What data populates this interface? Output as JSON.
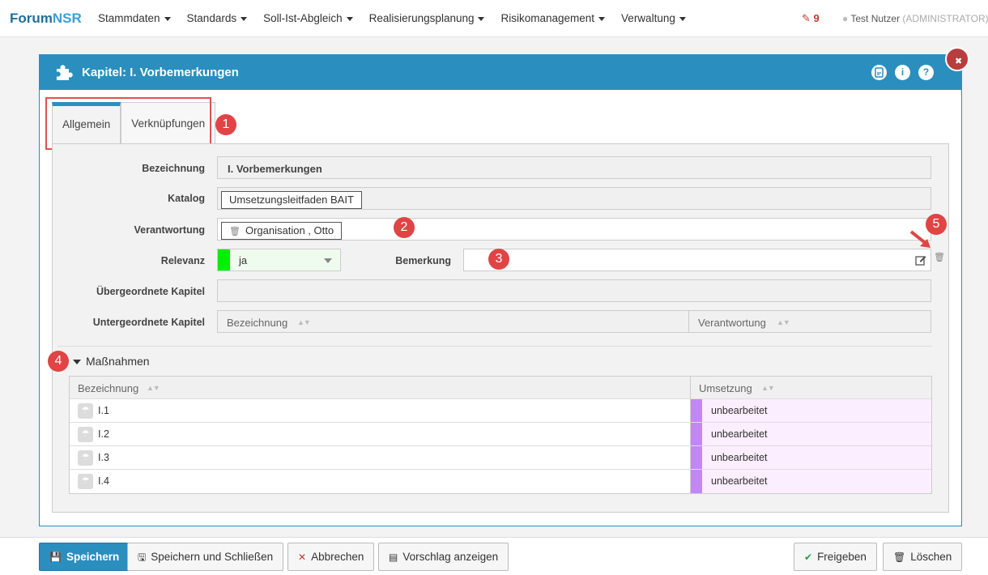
{
  "navbar": {
    "brand_part1": "Forum",
    "brand_part2": "NSR",
    "items": [
      {
        "label": "Stammdaten"
      },
      {
        "label": "Standards"
      },
      {
        "label": "Soll-Ist-Abgleich"
      },
      {
        "label": "Realisierungsplanung"
      },
      {
        "label": "Risikomanagement"
      },
      {
        "label": "Verwaltung"
      }
    ],
    "notification_count": "9",
    "user_name": "Test Nutzer",
    "user_role": "(ADMINISTRATOR)"
  },
  "panel": {
    "title": "Kapitel: I. Vorbemerkungen",
    "header_icons": [
      "pdf-icon",
      "info-icon",
      "help-icon"
    ],
    "info_glyph": "i",
    "help_glyph": "?",
    "close_glyph": "✖"
  },
  "tabs": [
    {
      "label": "Allgemein",
      "active": true
    },
    {
      "label": "Verknüpfungen",
      "active": false
    }
  ],
  "form": {
    "bezeichnung_label": "Bezeichnung",
    "bezeichnung_value": "I. Vorbemerkungen",
    "katalog_label": "Katalog",
    "katalog_value": "Umsetzungsleitfaden BAIT",
    "verantwortung_label": "Verantwortung",
    "verantwortung_value": "Organisation , Otto",
    "relevanz_label": "Relevanz",
    "relevanz_value": "ja",
    "relevanz_color": "#00f000",
    "bemerkung_label": "Bemerkung",
    "bemerkung_value": "",
    "uebergeordnete_label": "Übergeordnete Kapitel",
    "untergeordnete_label": "Untergeordnete Kapitel",
    "untergeordnete_columns": [
      "Bezeichnung",
      "Verantwortung"
    ]
  },
  "markers": [
    "1",
    "2",
    "3",
    "4",
    "5"
  ],
  "massnahmen": {
    "title": "Maßnahmen",
    "columns": [
      "Bezeichnung",
      "Umsetzung"
    ],
    "rows": [
      {
        "label": "I.1",
        "status": "unbearbeitet"
      },
      {
        "label": "I.2",
        "status": "unbearbeitet"
      },
      {
        "label": "I.3",
        "status": "unbearbeitet"
      },
      {
        "label": "I.4",
        "status": "unbearbeitet"
      }
    ],
    "status_color": "#c386f7"
  },
  "footer": {
    "save": "Speichern",
    "save_close": "Speichern und Schließen",
    "cancel": "Abbrechen",
    "proposal": "Vorschlag anzeigen",
    "release": "Freigeben",
    "delete": "Löschen"
  }
}
